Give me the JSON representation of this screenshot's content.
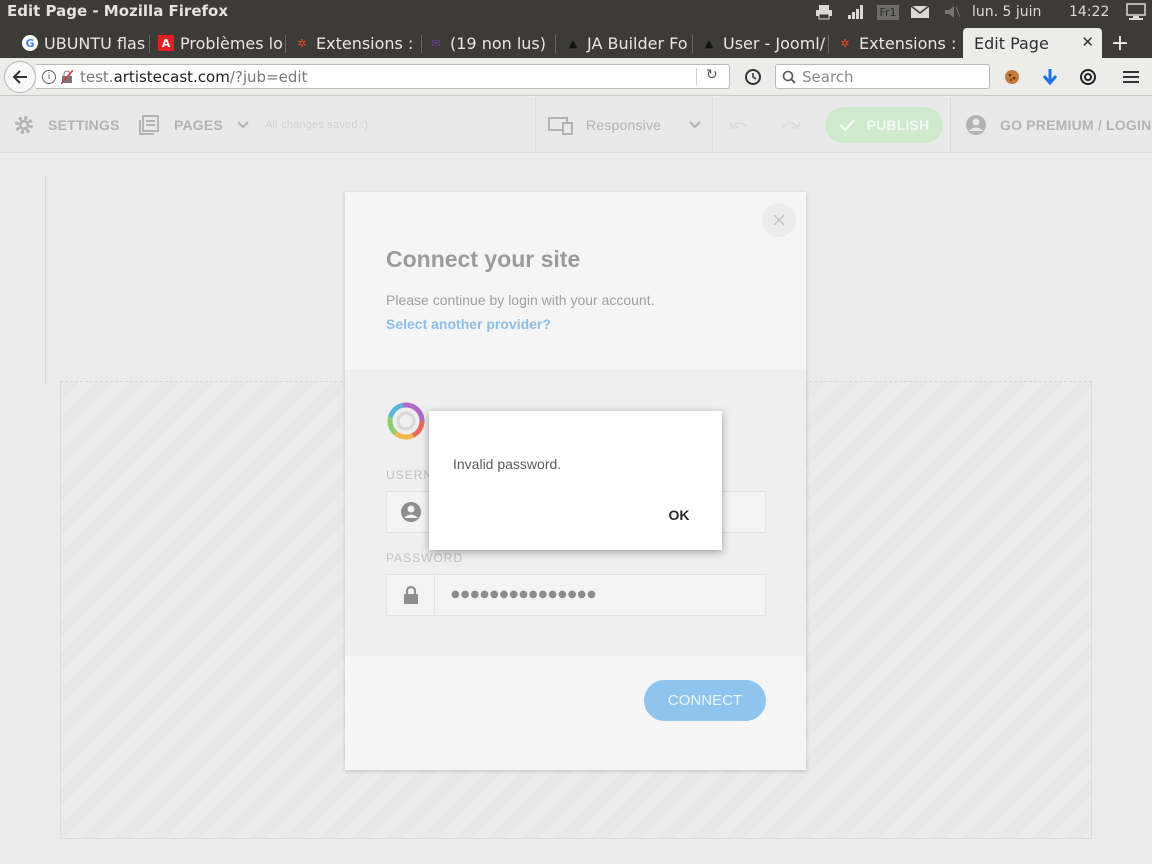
{
  "window": {
    "title": "Edit Page - Mozilla Firefox"
  },
  "system_tray": {
    "keyboard_layout": "Fr1",
    "date": "lun.  5 juin",
    "time": "14:22"
  },
  "tabs": [
    {
      "label": "UBUNTU flas"
    },
    {
      "label": "Problèmes lo"
    },
    {
      "label": "Extensions :"
    },
    {
      "label": "(19 non lus)"
    },
    {
      "label": "JA Builder Fo"
    },
    {
      "label": "User - Jooml/"
    },
    {
      "label": "Extensions :"
    },
    {
      "label": "Edit Page"
    }
  ],
  "navigation": {
    "url_prefix": "test.",
    "url_domain": "artistecast.com",
    "url_path": "/?jub=edit",
    "search_placeholder": "Search"
  },
  "app_toolbar": {
    "settings_label": "SETTINGS",
    "pages_label": "PAGES",
    "save_status": "All changes saved :)",
    "responsive_label": "Responsive",
    "publish_label": "PUBLISH",
    "premium_login_label": "GO PREMIUM / LOGIN"
  },
  "modal": {
    "title": "Connect your site",
    "description": "Please continue by login with your account.",
    "provider_link": "Select another provider?",
    "username_label": "USERN",
    "password_label": "PASSWORD",
    "password_value": "●●●●●●●●●●●●●●●",
    "connect_label": "CONNECT"
  },
  "alert": {
    "message": "Invalid password.",
    "ok_label": "OK"
  },
  "colors": {
    "publish": "#cfe9cf",
    "connect": "#8ec4ee",
    "link": "#8fbde6"
  }
}
